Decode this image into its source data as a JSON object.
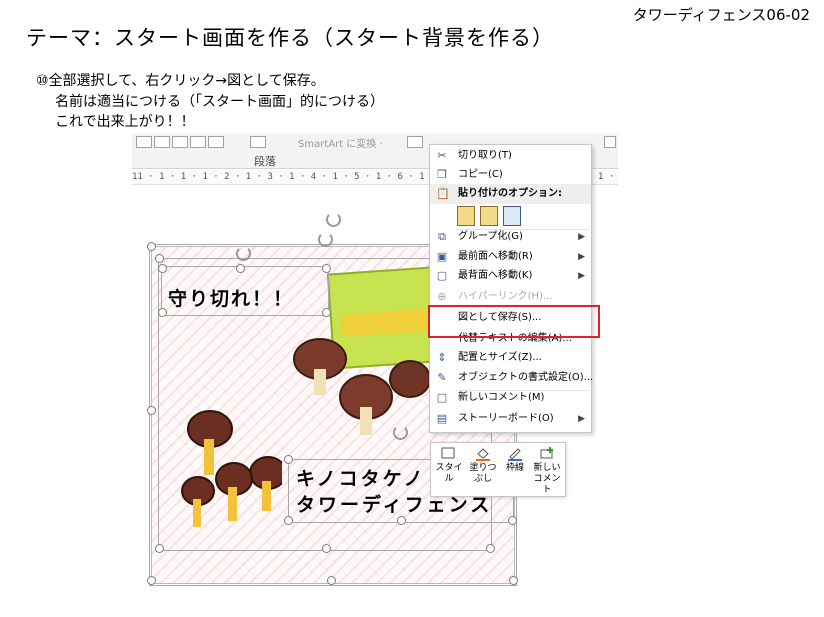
{
  "header": {
    "tag": "タワーディフェンス06-02",
    "title": "テーマ：スタート画面を作る（スタート背景を作る）"
  },
  "instructions": [
    "⑩全部選択して、右クリック→図として保存。",
    "名前は適当につける（「スタート画面」的につける）",
    "これで出来上がり！！"
  ],
  "ribbon": {
    "paragraph_label": "段落",
    "smartart_label": "SmartArt に変換 ·"
  },
  "ruler_text": "11 · 1 · 1 · 1 · 2 · 1 · 3 · 1 · 4 · 1 · 5 · 1 · 6 · 1 · 7 · 1 · 8 · 1 · 9 · 1 · 10 · 1 · 11 · 1 · 12 · 1 · 13 · 1",
  "canvas": {
    "title_text": "守り切れ！！",
    "game_name_line1": "キノコタケノ",
    "game_name_line2": "タワーディフェンス"
  },
  "context_menu": {
    "items": [
      {
        "label": "切り取り(T)",
        "icon": "scissors-icon",
        "enabled": true,
        "submenu": false
      },
      {
        "label": "コピー(C)",
        "icon": "copy-icon",
        "enabled": true,
        "submenu": false
      },
      {
        "label": "貼り付けのオプション:",
        "icon": "clipboard-icon",
        "enabled": true,
        "submenu": false,
        "header": true
      },
      {
        "label": "グループ化(G)",
        "icon": "group-icon",
        "enabled": true,
        "submenu": true
      },
      {
        "label": "最前面へ移動(R)",
        "icon": "bring-front-icon",
        "enabled": true,
        "submenu": true
      },
      {
        "label": "最背面へ移動(K)",
        "icon": "send-back-icon",
        "enabled": true,
        "submenu": true
      },
      {
        "label": "ハイパーリンク(H)...",
        "icon": "link-icon",
        "enabled": false,
        "submenu": false
      },
      {
        "label": "図として保存(S)...",
        "icon": "",
        "enabled": true,
        "submenu": false
      },
      {
        "label": "代替テキストの編集(A)...",
        "icon": "",
        "enabled": true,
        "submenu": false
      },
      {
        "label": "配置とサイズ(Z)...",
        "icon": "size-icon",
        "enabled": true,
        "submenu": false
      },
      {
        "label": "オブジェクトの書式設定(O)...",
        "icon": "format-icon",
        "enabled": true,
        "submenu": false
      },
      {
        "label": "新しいコメント(M)",
        "icon": "comment-icon",
        "enabled": true,
        "submenu": false
      },
      {
        "label": "ストーリーボード(O)",
        "icon": "storyboard-icon",
        "enabled": true,
        "submenu": true
      }
    ]
  },
  "mini_toolbar": {
    "style_label": "スタイル",
    "fill_label": "塗りつぶし",
    "outline_label": "枠線",
    "comment_label": "新しいコメント"
  },
  "colors": {
    "highlight": "#e0202a",
    "icon_blue": "#3a5b8c"
  }
}
